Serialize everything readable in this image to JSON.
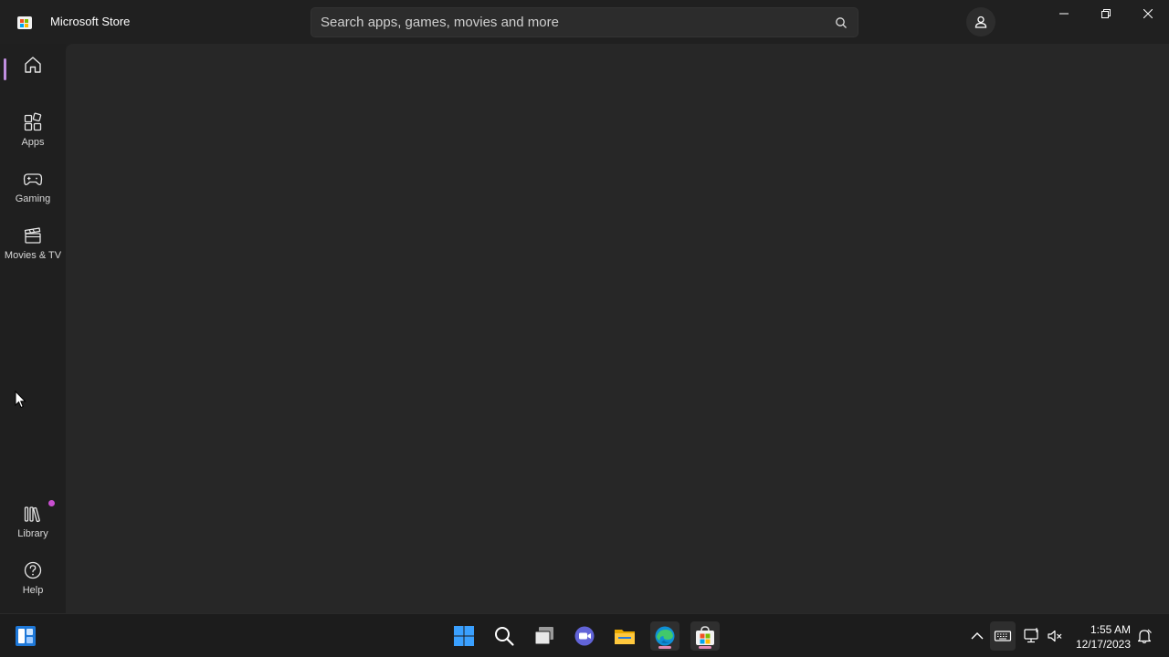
{
  "window": {
    "title": "Microsoft Store",
    "controls": {
      "minimize": "minimize-icon",
      "restore": "restore-icon",
      "close": "close-icon"
    }
  },
  "search": {
    "placeholder": "Search apps, games, movies and more",
    "value": ""
  },
  "nav": {
    "items": [
      {
        "id": "home",
        "label": "",
        "icon": "home-icon",
        "active": true
      },
      {
        "id": "apps",
        "label": "Apps",
        "icon": "apps-icon"
      },
      {
        "id": "gaming",
        "label": "Gaming",
        "icon": "controller-icon"
      },
      {
        "id": "movies",
        "label": "Movies & TV",
        "icon": "clapperboard-icon"
      },
      {
        "id": "library",
        "label": "Library",
        "icon": "library-icon",
        "badge": true
      },
      {
        "id": "help",
        "label": "Help",
        "icon": "help-icon"
      }
    ]
  },
  "taskbar": {
    "apps": [
      "start-icon",
      "search-icon",
      "task-view-icon",
      "teams-chat-icon",
      "file-explorer-icon",
      "edge-icon",
      "store-icon"
    ],
    "clock": {
      "time": "1:55 AM",
      "date": "12/17/2023"
    }
  },
  "colors": {
    "accent": "#c08fe0",
    "badge": "#c94fd1",
    "background": "#202020",
    "content": "#272727"
  }
}
